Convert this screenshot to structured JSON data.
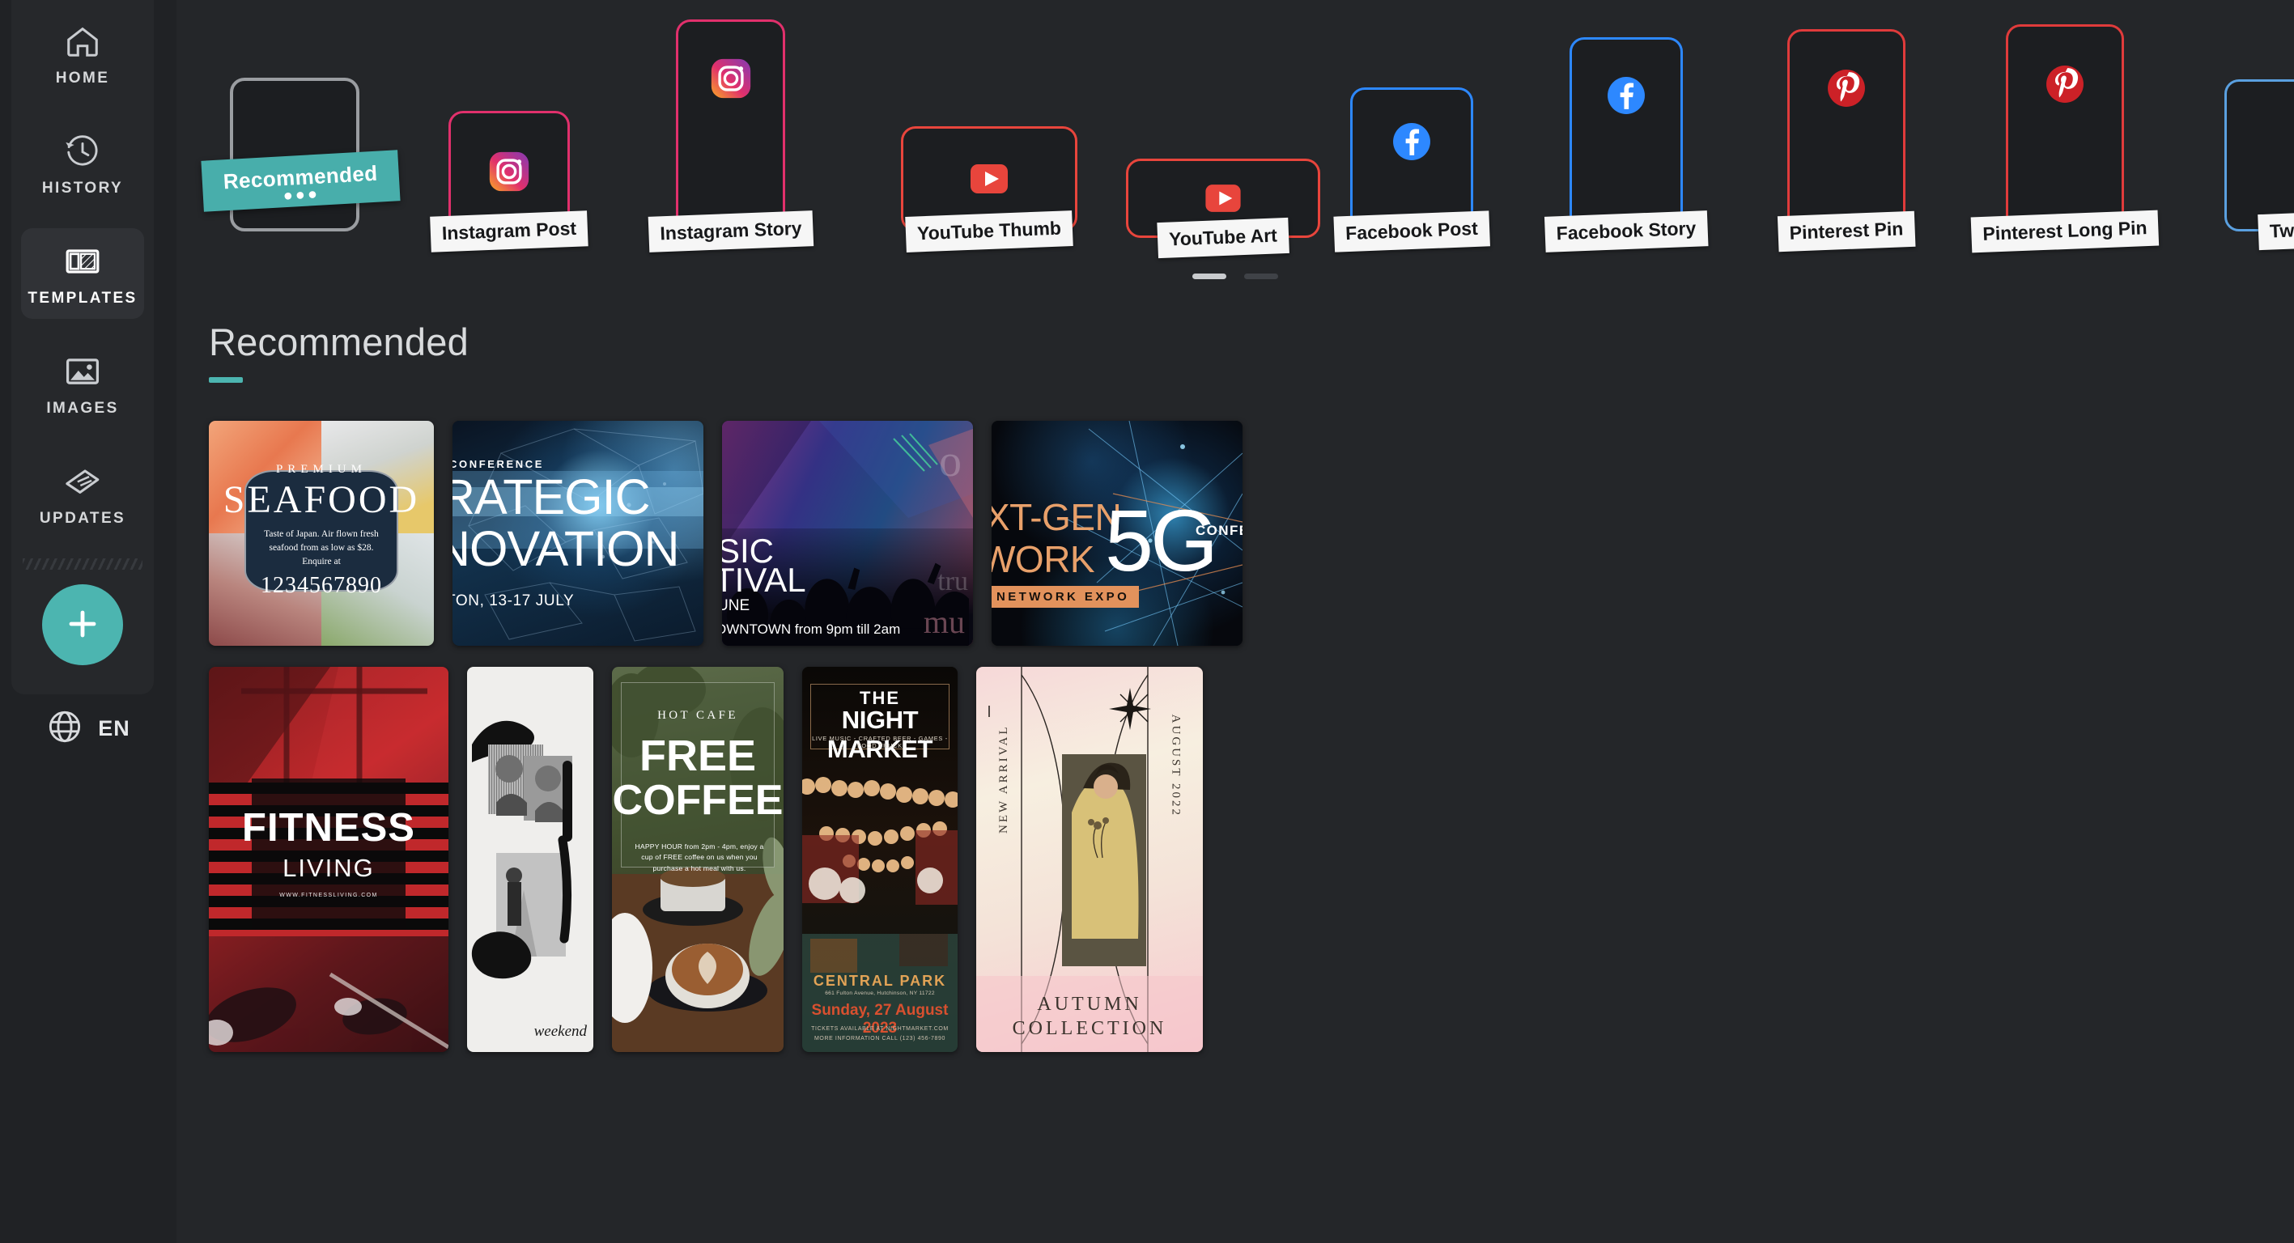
{
  "sidebar": {
    "items": [
      {
        "label": "HOME",
        "icon": "home-icon",
        "active": false
      },
      {
        "label": "HISTORY",
        "icon": "history-icon",
        "active": false
      },
      {
        "label": "TEMPLATES",
        "icon": "templates-icon",
        "active": true
      },
      {
        "label": "IMAGES",
        "icon": "images-icon",
        "active": false
      },
      {
        "label": "UPDATES",
        "icon": "updates-icon",
        "active": false
      }
    ],
    "create_button": {
      "icon": "plus-icon",
      "label": ""
    },
    "language": {
      "icon": "globe-icon",
      "label": "EN"
    }
  },
  "carousel": {
    "badge": {
      "text": "Recommended",
      "dots": "●●●",
      "color": "#48aeab"
    },
    "tiles": [
      {
        "label": "",
        "icon": "none",
        "color": "#9a9da1"
      },
      {
        "label": "Instagram Post",
        "icon": "instagram-icon",
        "color": "#e1306c"
      },
      {
        "label": "Instagram Story",
        "icon": "instagram-icon",
        "color": "#e1306c"
      },
      {
        "label": "YouTube Thumb",
        "icon": "youtube-icon",
        "color": "#e8453c"
      },
      {
        "label": "YouTube Art",
        "icon": "youtube-icon",
        "color": "#e8453c"
      },
      {
        "label": "Facebook Post",
        "icon": "facebook-icon",
        "color": "#2d88ff"
      },
      {
        "label": "Facebook Story",
        "icon": "facebook-icon",
        "color": "#2d88ff"
      },
      {
        "label": "Pinterest Pin",
        "icon": "pinterest-icon",
        "color": "#e03b3b"
      },
      {
        "label": "Pinterest Long Pin",
        "icon": "pinterest-icon",
        "color": "#e03b3b"
      },
      {
        "label": "Tw",
        "icon": "twitter-icon",
        "color": "#5aa0e0"
      }
    ],
    "pagination": {
      "count": 2,
      "active_index": 0
    }
  },
  "section": {
    "title": "Recommended",
    "accent_color": "#4cb5b0"
  },
  "templates": {
    "row1": [
      {
        "name": "premium-seafood",
        "pre": "PREMIUM",
        "title": "SEAFOOD",
        "body": "Taste of Japan. Air flown fresh seafood from as low as $28. Enquire at",
        "phone": "1234567890"
      },
      {
        "name": "strategic-innovation-conference",
        "kicker": "CONFERENCE",
        "title_line1": "RATEGIC",
        "title_line2": "NOVATION",
        "footer": "TON, 13-17 JULY"
      },
      {
        "name": "music-festival",
        "title_line1": "SIC",
        "title_line2": "TIVAL",
        "date": "UNE",
        "footer": "OWNTOWN from 9pm till 2am",
        "ghost1": "o",
        "ghost2": "tru",
        "ghost3": "mu"
      },
      {
        "name": "5g-network-expo",
        "title_line1": "XT-GEN",
        "title_line2": "WORK",
        "tag": "NETWORK EXPO",
        "big": "5G",
        "side": "CONFERE"
      }
    ],
    "row2": [
      {
        "name": "fitness-living",
        "title": "FITNESS",
        "subtitle": "LIVING",
        "url": "WWW.FITNESSLIVING.COM"
      },
      {
        "name": "weekend-collage",
        "script": "weekend"
      },
      {
        "name": "free-coffee",
        "kicker": "HOT CAFE",
        "title_line1": "FREE",
        "title_line2": "COFFEE",
        "body": "HAPPY HOUR from 2pm - 4pm, enjoy a cup of FREE coffee on us when you purchase a hot meal with us."
      },
      {
        "name": "the-night-market",
        "the": "THE",
        "title": "NIGHT MARKET",
        "tagline": "LIVE MUSIC  -  CRAFTED BEER  -  GAMES  -  FOOD TRUCK",
        "venue": "CENTRAL PARK",
        "address": "661 Fulton Avenue, Hutchinson, NY 11722",
        "date": "Sunday, 27 August 2023",
        "tickets": "TICKETS AVAILABLE AT NIGHTMARKET.COM",
        "info": "MORE INFORMATION CALL (123) 456-7890"
      },
      {
        "name": "autumn-collection",
        "left_label": "NEW ARRIVAL",
        "right_label": "AUGUST 2022",
        "title_line1": "AUTUMN",
        "title_line2": "COLLECTION"
      }
    ]
  }
}
